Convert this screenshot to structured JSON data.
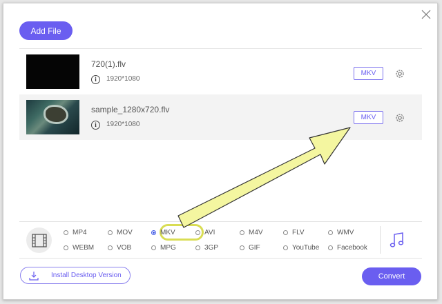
{
  "toolbar": {
    "add_file_label": "Add File"
  },
  "files": [
    {
      "name": "720(1).flv",
      "resolution": "1920*1080",
      "format": "MKV",
      "info_glyph": "i"
    },
    {
      "name": "sample_1280x720.flv",
      "resolution": "1920*1080",
      "format": "MKV",
      "info_glyph": "i"
    }
  ],
  "formats": {
    "row1": [
      "MP4",
      "MOV",
      "MKV",
      "AVI",
      "M4V",
      "FLV",
      "WMV"
    ],
    "row2": [
      "WEBM",
      "VOB",
      "MPG",
      "3GP",
      "GIF",
      "YouTube",
      "Facebook"
    ],
    "selected": "MKV"
  },
  "footer": {
    "install_label": "Install Desktop Version",
    "convert_label": "Convert"
  },
  "colors": {
    "accent": "#6a5ef0",
    "highlight": "#d9dd54",
    "arrow_fill": "#f4f6a0"
  }
}
